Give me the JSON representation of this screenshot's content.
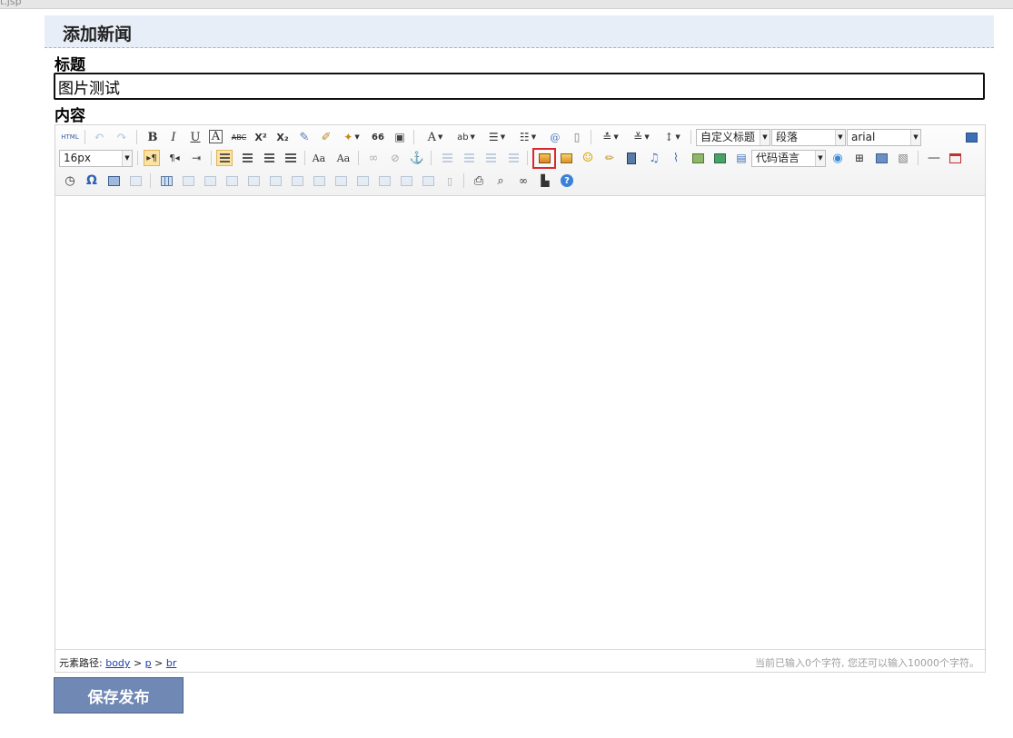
{
  "browser": {
    "tab_fragment": "t.jsp"
  },
  "page": {
    "heading": "添加新闻"
  },
  "form": {
    "title_label": "标题",
    "title_value": "图片测试",
    "content_label": "内容",
    "save_label": "保存发布"
  },
  "editor": {
    "toolbar": {
      "html_label": "HTML",
      "bold": "B",
      "italic": "I",
      "underline": "U",
      "border_text": "A",
      "strikethrough": "ABC",
      "superscript": "X²",
      "subscript": "X₂",
      "quote": "66",
      "font_color": "A",
      "highlight": "ab",
      "custom_heading": "自定义标题",
      "paragraph": "段落",
      "font_family": "arial",
      "font_size": "16px",
      "code_language": "代码语言",
      "omega": "Ω",
      "font_ab1": "Aa",
      "font_ab2": "Aa",
      "help": "?"
    },
    "status": {
      "path_label": "元素路径:",
      "path_body": "body",
      "path_sep1": ">",
      "path_p": "p",
      "path_sep2": ">",
      "path_br": "br",
      "counter": "当前已输入0个字符, 您还可以输入10000个字符。"
    }
  },
  "colors": {
    "header_bg": "#e8eef7",
    "save_button_bg": "#6f88b4",
    "highlight_border": "#d9282e"
  }
}
